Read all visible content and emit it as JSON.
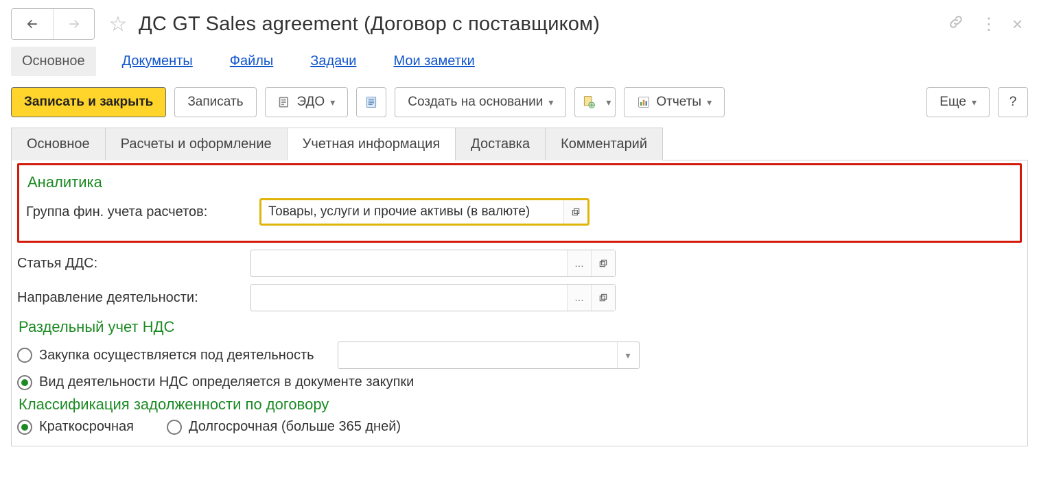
{
  "header": {
    "title": "ДС GT Sales agreement (Договор с поставщиком)"
  },
  "sectionNav": {
    "items": [
      "Основное",
      "Документы",
      "Файлы",
      "Задачи",
      "Мои заметки"
    ],
    "active_index": 0
  },
  "toolbar": {
    "save_close": "Записать и закрыть",
    "save": "Записать",
    "edo": "ЭДО",
    "create_based": "Создать на основании",
    "reports": "Отчеты",
    "more": "Еще",
    "help": "?"
  },
  "tabs": {
    "items": [
      "Основное",
      "Расчеты и оформление",
      "Учетная информация",
      "Доставка",
      "Комментарий"
    ],
    "active_index": 2
  },
  "form": {
    "analytics_title": "Аналитика",
    "fin_group_label": "Группа фин. учета расчетов:",
    "fin_group_value": "Товары, услуги и прочие активы (в валюте)",
    "dds_label": "Статья ДДС:",
    "dds_value": "",
    "direction_label": "Направление деятельности:",
    "direction_value": "",
    "vat_title": "Раздельный учет НДС",
    "vat_option1": "Закупка осуществляется под деятельность",
    "vat_option2": "Вид деятельности НДС определяется в документе закупки",
    "vat_selected": 1,
    "debt_title": "Классификация задолженности по договору",
    "debt_option1": "Краткосрочная",
    "debt_option2": "Долгосрочная (больше 365 дней)",
    "debt_selected": 0
  }
}
